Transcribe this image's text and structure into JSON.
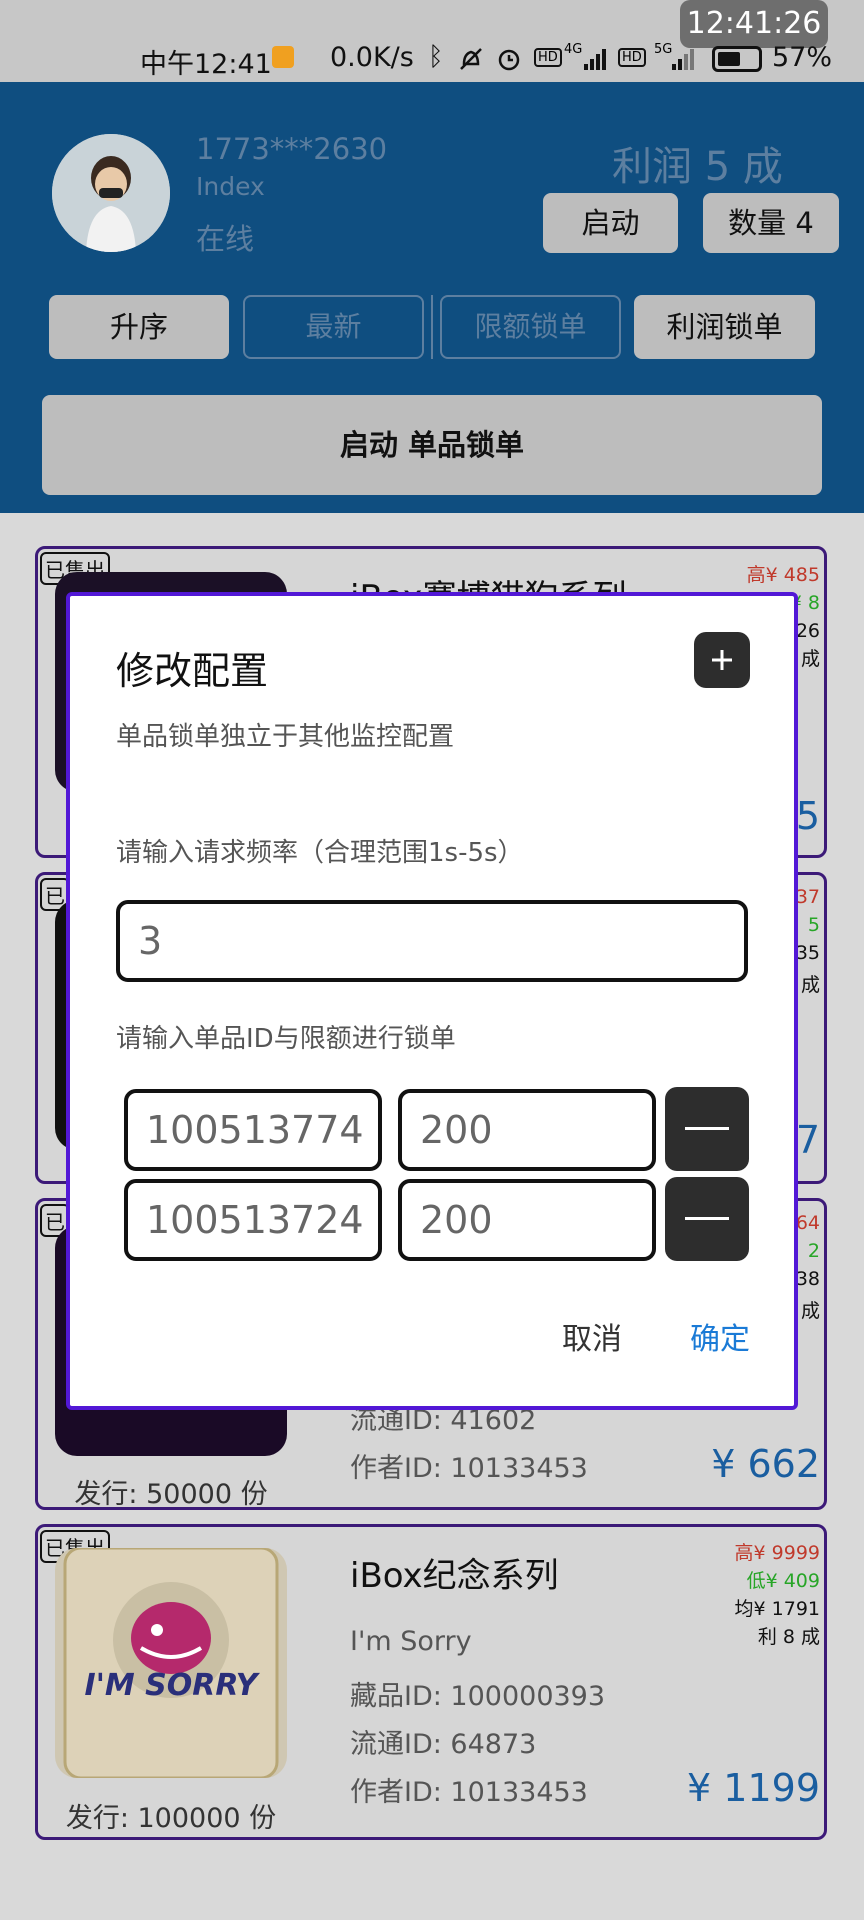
{
  "status_bar": {
    "clock_pill": "12:41:26",
    "left_time": "中午12:41",
    "net_speed": "0.0K/s",
    "battery": "57%",
    "labels": [
      "HD",
      "4G",
      "HD",
      "5G"
    ]
  },
  "header": {
    "phone": "1773***2630",
    "index_label": "Index",
    "status": "在线",
    "profit": "利润 5 成",
    "start_label": "启动",
    "quantity_label": "数量 4",
    "sort_buttons": [
      "升序",
      "最新",
      "限额锁单",
      "利润锁单"
    ],
    "start_single_lock": "启动 单品锁单"
  },
  "cards": [
    {
      "sold": "已售出",
      "title": "iBox赛博猫狗系列",
      "high": "高¥ 485",
      "low": "低¥ 8",
      "avg": "均¥ 26",
      "profit": "利 成",
      "price": "5"
    },
    {
      "sold": "已",
      "high": "37",
      "low": "5",
      "avg": "35",
      "profit": "成",
      "price": "7"
    },
    {
      "sold": "已",
      "high": "64",
      "low": "2",
      "avg": "38",
      "profit": "成",
      "circulation": "流通ID: 41602",
      "author": "作者ID: 10133453",
      "price": "¥ 662",
      "issue": "发行: 50000 份"
    },
    {
      "sold": "已售出",
      "title": "iBox纪念系列",
      "subtitle": "I'm Sorry",
      "collection": "藏品ID: 100000393",
      "circulation": "流通ID: 64873",
      "author": "作者ID: 10133453",
      "high": "高¥ 9999",
      "low": "低¥ 409",
      "avg": "均¥ 1791",
      "profit": "利 8 成",
      "price": "¥ 1199",
      "issue": "发行: 100000 份",
      "thumb_text": "I'M SORRY"
    }
  ],
  "dialog": {
    "title": "修改配置",
    "subtitle": "单品锁单独立于其他监控配置",
    "freq_label": "请输入请求频率（合理范围1s-5s）",
    "freq_value": "3",
    "id_label": "请输入单品ID与限额进行锁单",
    "rows": [
      {
        "id": "100513774",
        "limit": "200"
      },
      {
        "id": "100513724",
        "limit": "200"
      }
    ],
    "cancel": "取消",
    "confirm": "确定"
  },
  "colors": {
    "accent": "#1a7ad6",
    "dialog_border": "#5218d6",
    "high": "#c0392b",
    "low": "#27a527",
    "header_bg": "#0f4e80"
  }
}
